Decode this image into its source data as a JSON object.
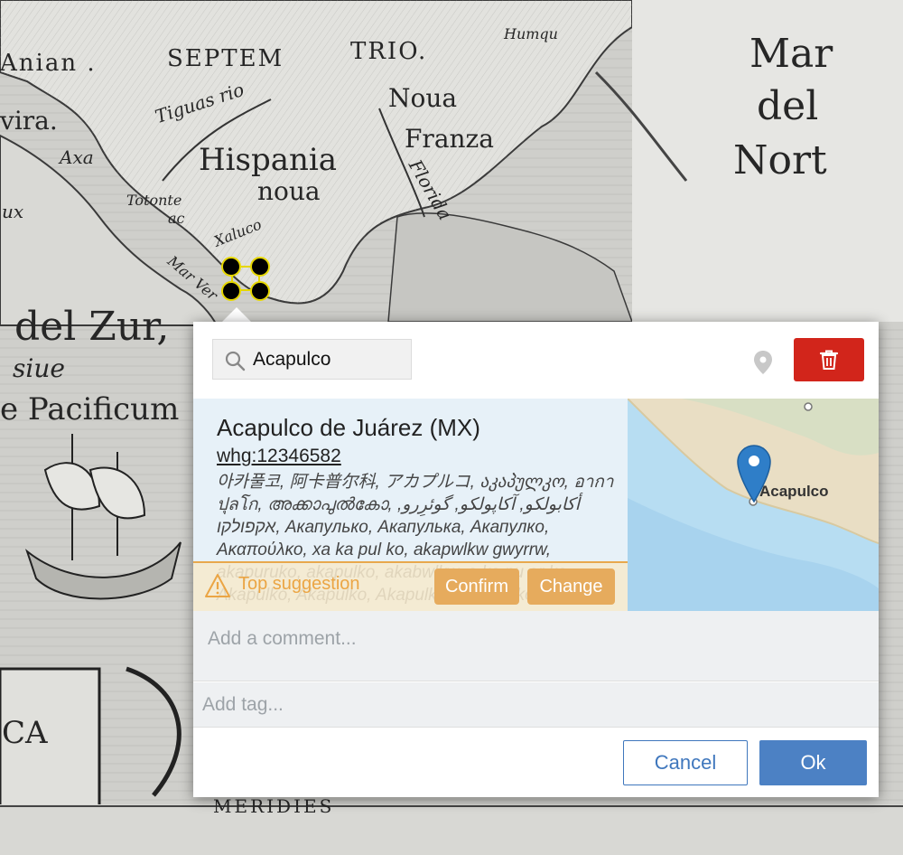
{
  "map": {
    "labels": {
      "anian": "Anian .",
      "septem": "SEPTEM",
      "trio": "TRIO.",
      "humque": "Humqu",
      "mar": "Mar",
      "del": "del",
      "nort": "Nort",
      "tiguas": "Tiguas rio",
      "vira": "vira.",
      "noua1": "Noua",
      "franza": "Franza",
      "axa": "Axa",
      "hispania": "Hispania",
      "noua2": "noua",
      "florida": "Florida",
      "totonte": "Totonte",
      "ac": "ac",
      "xaluco": "Xaluco",
      "ux": "ux",
      "marver": "Mar Ver",
      "delzur": "del Zur,",
      "siue": "siue",
      "pacificum": "e Pacificum",
      "ca": "CA",
      "meridies": "MERIDIES"
    }
  },
  "popup": {
    "search": {
      "value": "Acapulco",
      "icon": "search-icon"
    },
    "pin_icon": "map-pin-icon",
    "delete_icon": "trash-icon",
    "result": {
      "title": "Acapulco de Juárez (MX)",
      "id": "whg:12346582",
      "alt_names": "아카풀코, 阿卡普尔科, アカプルコ, აკაპულკო, อากาปุลโก, അക്കാപുൽകോ, أكابولكو, آکاپولکو, گوئرِرو, אקפולקו, Акапулько, Акапулька, Акапулко, Ακαπούλκο, xa ka pul ko, akapwlkw gwyrrw, akapuruko, akapulko, akabwlkw, a ka pu er ke, Akapúlkó, Akapulko, Akapulkas, Akapulkō"
    },
    "flag": {
      "label": "Top suggestion",
      "icon": "warning-icon",
      "confirm_label": "Confirm",
      "change_label": "Change"
    },
    "mini_map": {
      "place_label": "Acapulco",
      "marker_icon": "map-marker-icon"
    },
    "comment": {
      "placeholder": "Add a comment..."
    },
    "tag": {
      "placeholder": "Add tag..."
    },
    "actions": {
      "cancel_label": "Cancel",
      "ok_label": "Ok"
    }
  }
}
